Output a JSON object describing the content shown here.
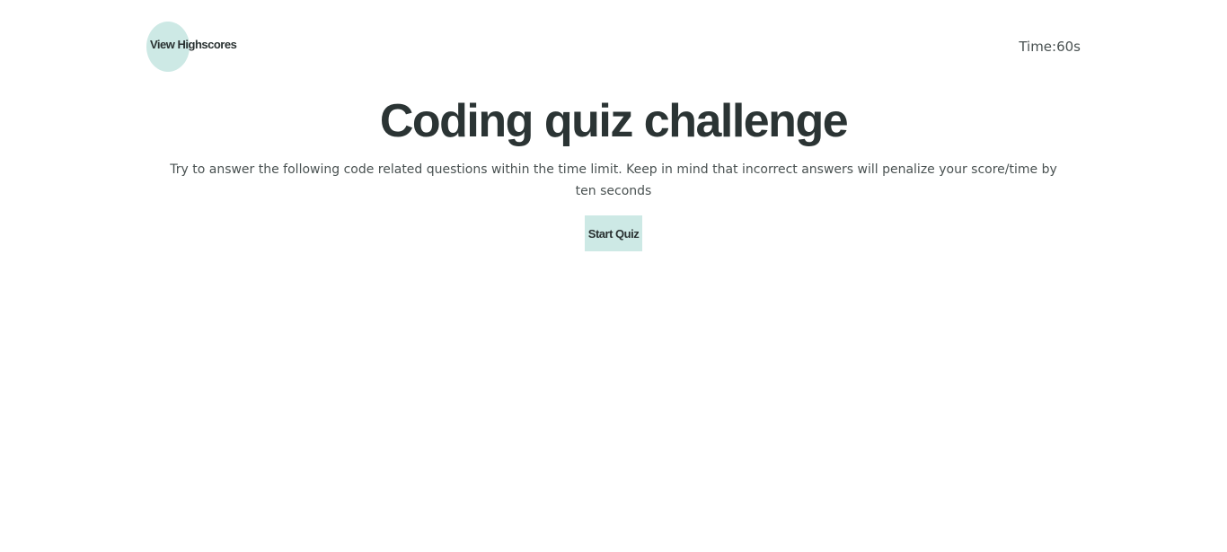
{
  "header": {
    "highscores_label": "View Highscores",
    "timer_label": "Time:",
    "timer_value": "60s"
  },
  "main": {
    "title": "Coding quiz challenge",
    "description": "Try to answer the following code related questions within the time limit. Keep in mind that incorrect answers will penalize your score/time by ten seconds",
    "start_label": "Start Quiz"
  },
  "colors": {
    "accent": "#cde9e5",
    "text_dark": "#2b3434",
    "text_muted": "#4a5252",
    "background": "#ffffff"
  }
}
